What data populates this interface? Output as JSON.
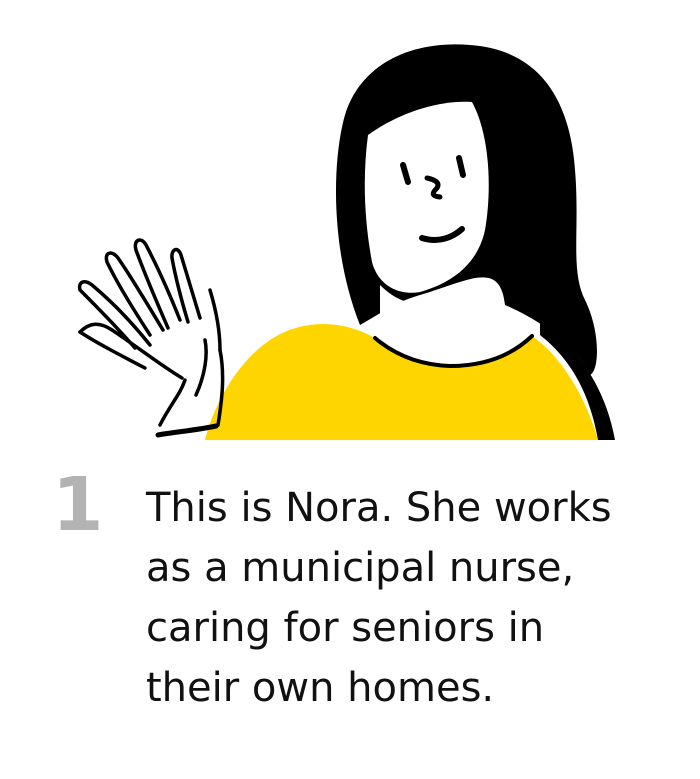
{
  "step": {
    "number": "1"
  },
  "caption": {
    "lines": [
      "This is Nora. She works",
      "as a municipal nurse,",
      "caring for seniors in",
      "their own homes."
    ]
  },
  "illustration": {
    "subject": "waving-woman",
    "colors": {
      "sweater": "#FFD500",
      "hair": "#000000",
      "outline": "#000000",
      "skin": "#FFFFFF"
    }
  },
  "colors": {
    "step_number": "#B3B3B3",
    "text": "#111111",
    "background": "#FFFFFF"
  }
}
